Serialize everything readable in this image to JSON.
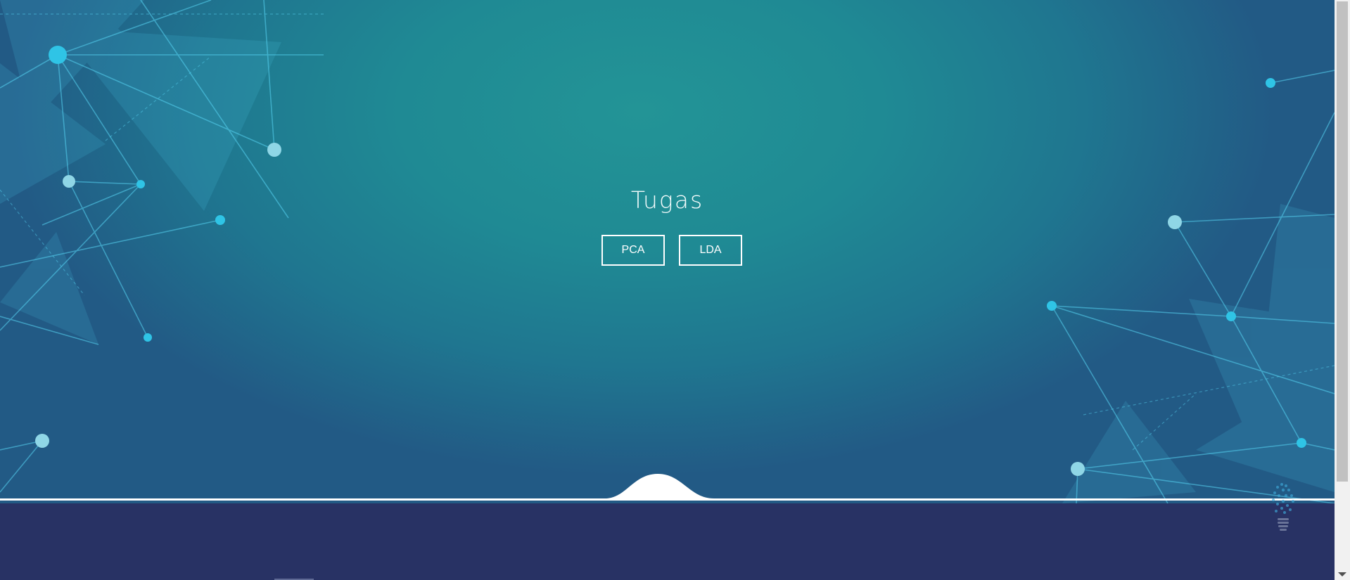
{
  "hero": {
    "title": "Tugas",
    "buttons": [
      {
        "label": "PCA"
      },
      {
        "label": "LDA"
      }
    ]
  },
  "icons": {
    "background": "network-mesh",
    "logo": "lightbulb-logo"
  },
  "colors": {
    "hero_center": "#239496",
    "hero_edge": "#225a85",
    "footer": "#283264",
    "button_border": "#ffffff"
  }
}
